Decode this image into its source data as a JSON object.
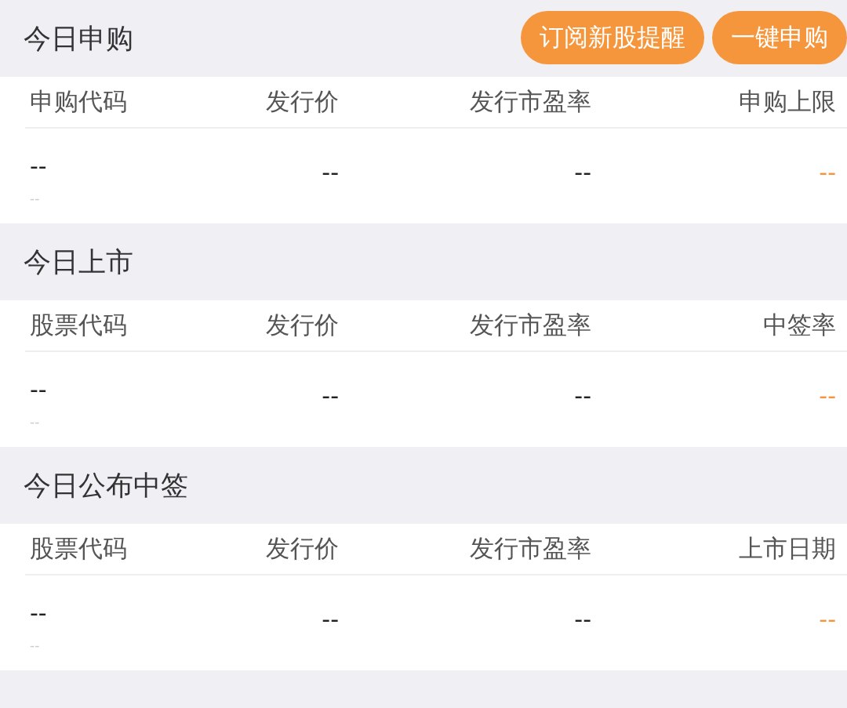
{
  "sections": [
    {
      "title": "今日申购",
      "buttons": [
        "订阅新股提醒",
        "一键申购"
      ],
      "columns": [
        "申购代码",
        "发行价",
        "发行市盈率",
        "申购上限"
      ],
      "rows": [
        {
          "cells": [
            {
              "text": "--",
              "sub": "--",
              "accent": false
            },
            {
              "text": "--",
              "accent": false
            },
            {
              "text": "--",
              "accent": false
            },
            {
              "text": "--",
              "accent": true
            }
          ]
        }
      ]
    },
    {
      "title": "今日上市",
      "columns": [
        "股票代码",
        "发行价",
        "发行市盈率",
        "中签率"
      ],
      "rows": [
        {
          "cells": [
            {
              "text": "--",
              "sub": "--",
              "accent": false
            },
            {
              "text": "--",
              "accent": false
            },
            {
              "text": "--",
              "accent": false
            },
            {
              "text": "--",
              "accent": true
            }
          ]
        }
      ]
    },
    {
      "title": "今日公布中签",
      "columns": [
        "股票代码",
        "发行价",
        "发行市盈率",
        "上市日期"
      ],
      "rows": [
        {
          "cells": [
            {
              "text": "--",
              "sub": "--",
              "accent": false
            },
            {
              "text": "--",
              "accent": false
            },
            {
              "text": "--",
              "accent": false
            },
            {
              "text": "--",
              "accent": true
            }
          ]
        }
      ]
    }
  ]
}
